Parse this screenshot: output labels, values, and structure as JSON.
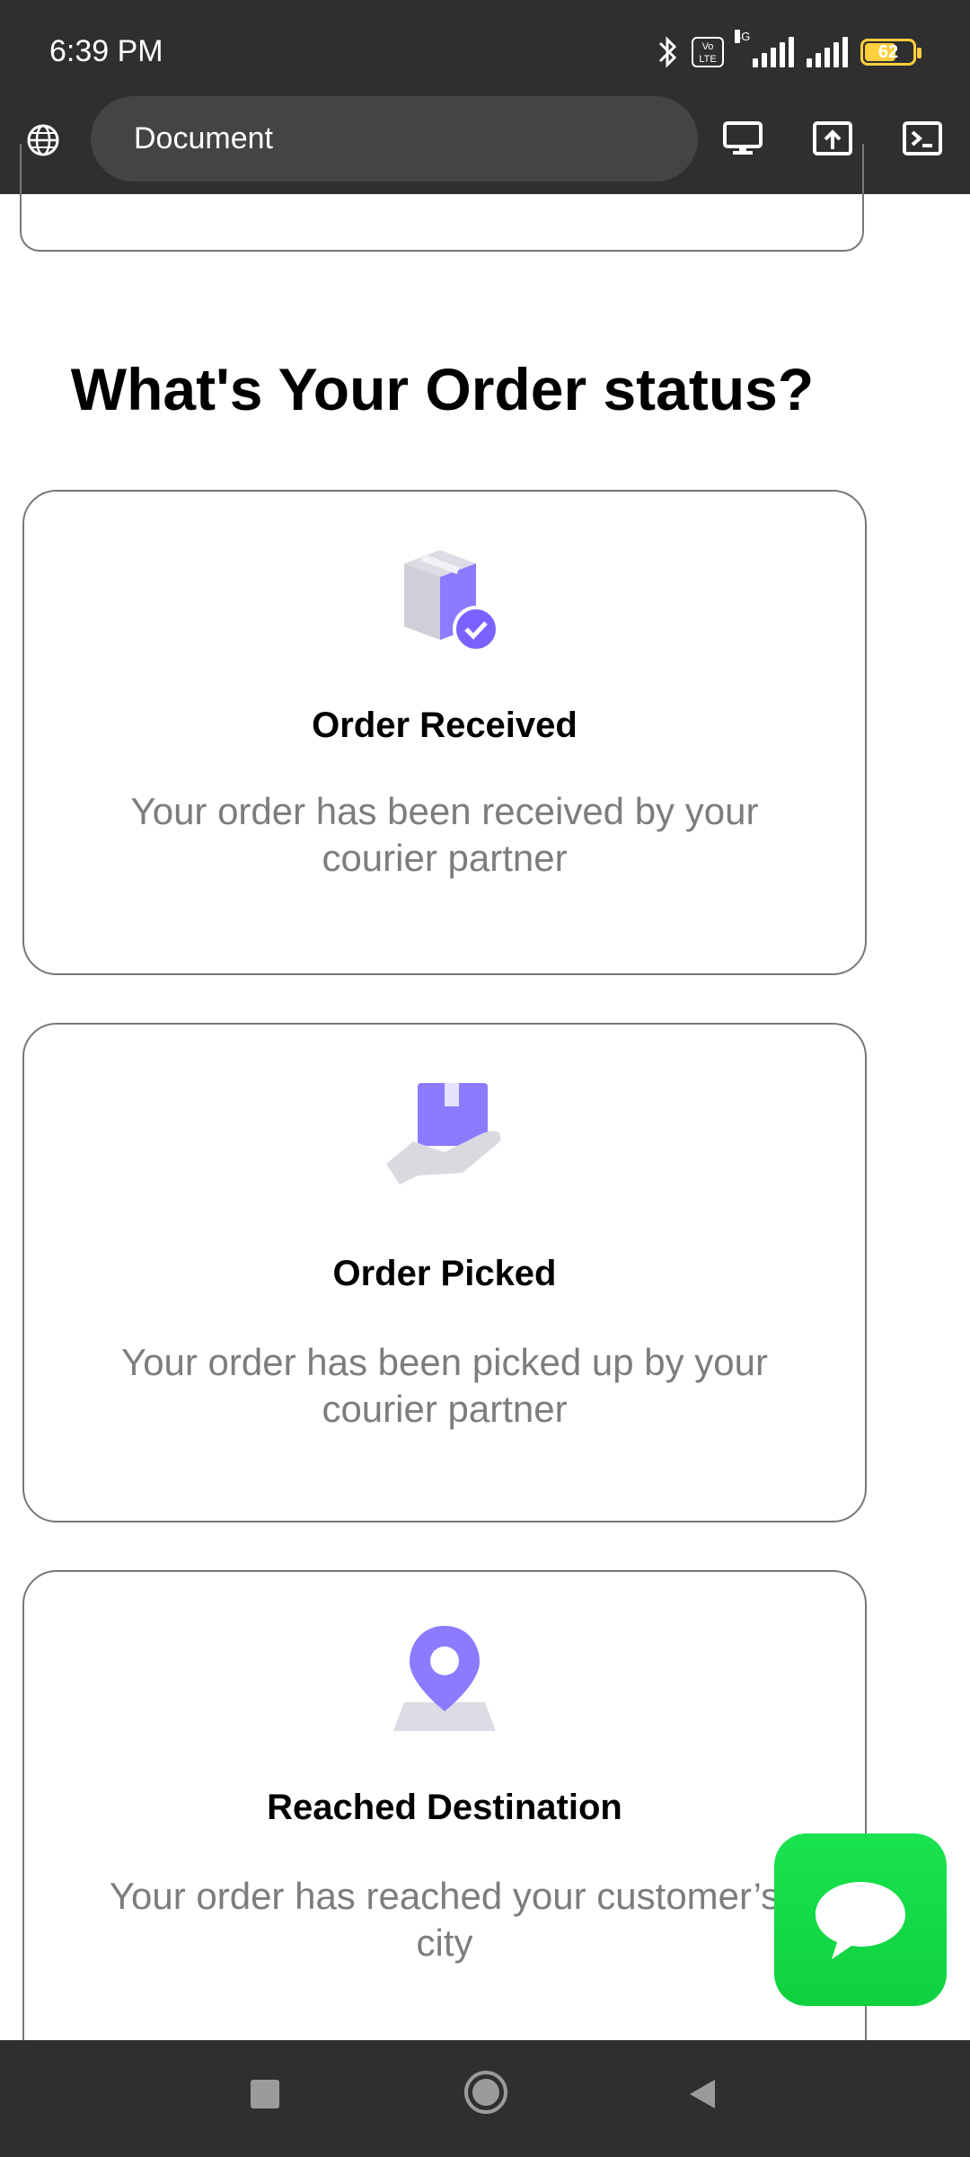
{
  "status_bar": {
    "time": "6:39 PM",
    "network": "4G",
    "volte": "Vo LTE",
    "battery": "62"
  },
  "browser": {
    "address_text": "Document"
  },
  "page": {
    "title": "What's Your Order status?"
  },
  "cards": [
    {
      "title": "Order Received",
      "description": "Your order has been received by your courier partner",
      "icon": "package-check-icon"
    },
    {
      "title": "Order Picked",
      "description": "Your order has been picked up by your courier partner",
      "icon": "hand-package-icon"
    },
    {
      "title": "Reached Destination",
      "description": "Your order has reached your customer’s city",
      "icon": "location-pin-icon"
    }
  ],
  "colors": {
    "accent": "#7b61ff",
    "chat_green": "#16d84a",
    "bar_bg": "#2f2f2f"
  }
}
